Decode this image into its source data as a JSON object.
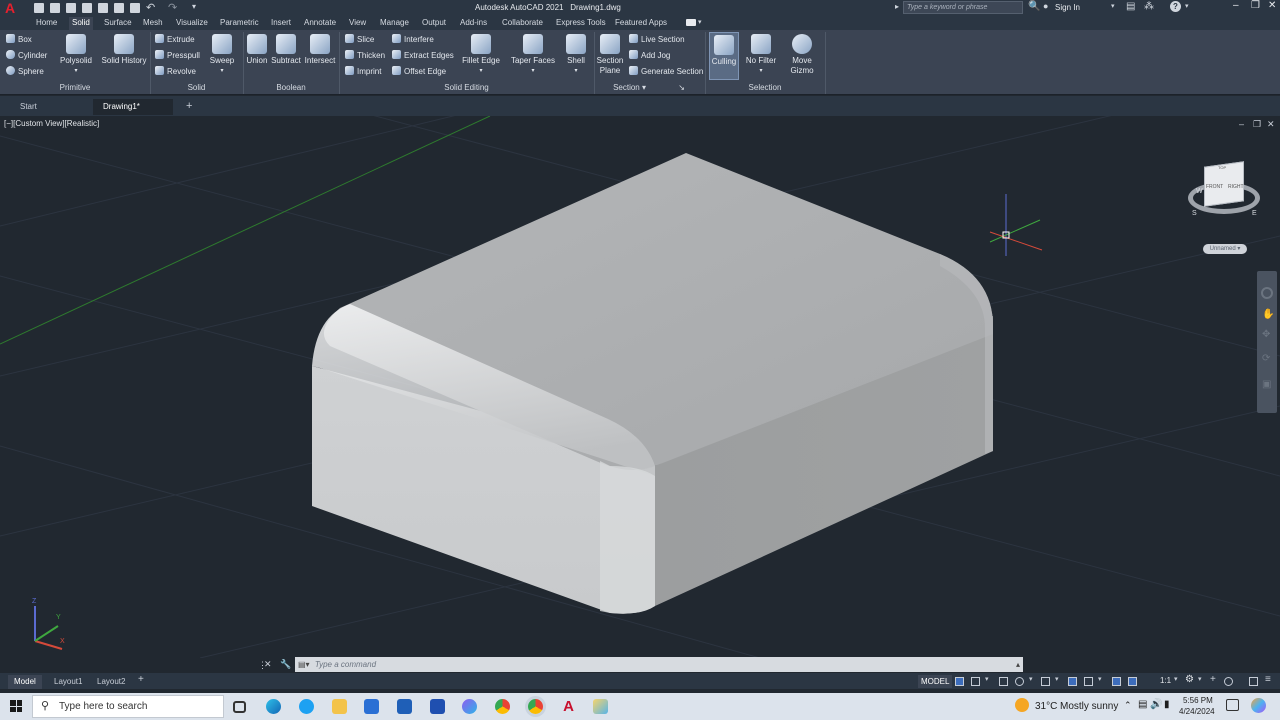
{
  "title": {
    "app": "Autodesk AutoCAD 2021",
    "file": "Drawing1.dwg",
    "search_placeholder": "Type a keyword or phrase",
    "sign_in": "Sign In"
  },
  "menu_tabs": [
    "Home",
    "Solid",
    "Surface",
    "Mesh",
    "Visualize",
    "Parametric",
    "Insert",
    "Annotate",
    "View",
    "Manage",
    "Output",
    "Add-ins",
    "Collaborate",
    "Express Tools",
    "Featured Apps"
  ],
  "active_tab": "Solid",
  "ribbon": {
    "primitive": {
      "label": "Primitive",
      "box": "Box",
      "cylinder": "Cylinder",
      "sphere": "Sphere",
      "polysolid": "Polysolid",
      "solid_history": "Solid History"
    },
    "solid": {
      "label": "Solid",
      "extrude": "Extrude",
      "presspull": "Presspull",
      "revolve": "Revolve",
      "sweep": "Sweep"
    },
    "boolean": {
      "label": "Boolean",
      "union": "Union",
      "subtract": "Subtract",
      "intersect": "Intersect"
    },
    "solid_editing": {
      "label": "Solid Editing",
      "slice": "Slice",
      "thicken": "Thicken",
      "imprint": "Imprint",
      "interfere": "Interfere",
      "extract_edges": "Extract Edges",
      "offset_edge": "Offset Edge",
      "fillet_edge": "Fillet Edge",
      "taper_faces": "Taper Faces",
      "shell": "Shell"
    },
    "section": {
      "label": "Section",
      "section_plane_1": "Section",
      "section_plane_2": "Plane",
      "live_section": "Live Section",
      "add_jog": "Add Jog",
      "generate_section": "Generate Section"
    },
    "selection": {
      "label": "Selection",
      "culling": "Culling",
      "no_filter": "No Filter",
      "move_gizmo_1": "Move",
      "move_gizmo_2": "Gizmo"
    }
  },
  "file_tabs": [
    "Start",
    "Drawing1*"
  ],
  "viewport": {
    "label": "[−][Custom View][Realistic]",
    "viewcube": {
      "front": "FRONT",
      "right": "RIGHT",
      "top": "TOP",
      "w": "W",
      "s": "S",
      "e": "E"
    },
    "ucs_label": "Unnamed",
    "axes": {
      "x": "X",
      "y": "Y",
      "z": "Z"
    }
  },
  "command": {
    "placeholder": "Type a command"
  },
  "layout_tabs": [
    "Model",
    "Layout1",
    "Layout2"
  ],
  "status": {
    "model": "MODEL",
    "scale": "1:1"
  },
  "taskbar": {
    "search_placeholder": "Type here to search",
    "weather_temp": "31°C",
    "weather_desc": "Mostly sunny",
    "time": "5:56 PM",
    "date": "4/24/2024"
  },
  "colors": {
    "accent_red": "#c8102e",
    "ribbon_bg": "#3b4453",
    "viewport_bg": "#212830"
  }
}
